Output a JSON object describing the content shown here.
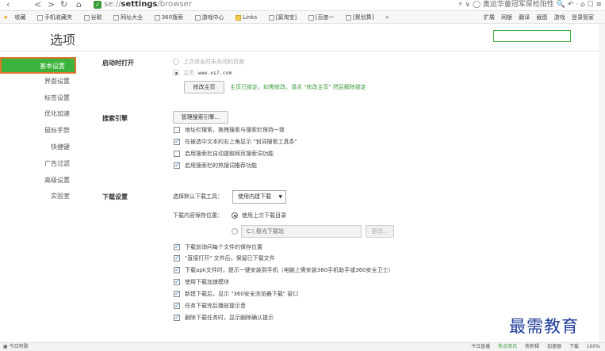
{
  "browser": {
    "url_prefix": "se://",
    "url_path": "settings",
    "url_suffix": "/browser",
    "right_tools": "⚡ ∨ ◯ 奥运华董冠军尿检阳性  🔍  ↶ · ⌂ ☐ ≡",
    "bookmarks": [
      "收藏",
      "手机收藏夹",
      "谷歌",
      "网址大全",
      "360搜索",
      "游戏中心",
      "Links",
      "[窦淘宝]",
      "[百度一",
      "[聚划算]",
      "»"
    ],
    "bookmark_tools": [
      "扩展",
      "网银",
      "翻译",
      "截图",
      "游戏",
      "登录管家"
    ]
  },
  "page": {
    "title": "选项",
    "search_value": ""
  },
  "sidebar": {
    "items": [
      {
        "label": "基本设置",
        "active": true
      },
      {
        "label": "界面设置",
        "active": false
      },
      {
        "label": "标签设置",
        "active": false
      },
      {
        "label": "优化加速",
        "active": false
      },
      {
        "label": "鼠标手势",
        "active": false
      },
      {
        "label": "快捷键",
        "active": false
      },
      {
        "label": "广告过滤",
        "active": false
      },
      {
        "label": "高级设置",
        "active": false
      },
      {
        "label": "实验室",
        "active": false
      }
    ]
  },
  "startup": {
    "title": "启动时打开",
    "option_last": "上次退出时未关闭的页面",
    "option_home_label": "主页",
    "home_url": "www.xs7.com",
    "modify_button": "修改主页",
    "locked_note": "主页已锁定，如需修改，请点 \"修改主页\" 然后解除锁定"
  },
  "search": {
    "title": "搜索引擎",
    "manage_button": "管理搜索引擎...",
    "options": [
      {
        "label": "地址栏搜索，拖拽搜索与搜索栏保持一致",
        "checked": false
      },
      {
        "label": "在被选中文本的右上角显示 \"划词搜索工具条\"",
        "checked": true
      },
      {
        "label": "启用搜索栏自动提取网页搜索词功能",
        "checked": false
      },
      {
        "label": "启用搜索栏的热搜词推荐功能",
        "checked": true
      }
    ]
  },
  "download": {
    "title": "下载设置",
    "tool_label": "选择默认下载工具：",
    "tool_value": "使用内建下载",
    "location_label": "下载内容保存位置：",
    "location_last": "使用上次下载目录",
    "path_value": "C:\\ 极光下载站",
    "change_button": "更改...",
    "options": [
      {
        "label": "下载前询问每个文件的保存位置",
        "checked": true
      },
      {
        "label": "\"直接打开\" 文件后，保留已下载文件",
        "checked": true
      },
      {
        "label": "下载apk文件时，提示一键安装到手机（电脑上需安装360手机助手或360安全卫士）",
        "checked": true
      },
      {
        "label": "使用下载加速模块",
        "checked": true
      },
      {
        "label": "新建下载后，显示 \"360安全浏览器下载\" 窗口",
        "checked": true
      },
      {
        "label": "任务下载完后播放提示音",
        "checked": true
      },
      {
        "label": "删除下载任务时，显示删除确认提示",
        "checked": true
      }
    ]
  },
  "watermark": "最需教育",
  "statusbar": {
    "left": "今日特歌",
    "right": [
      "今日直播",
      "热点资讯",
      "快剪辑",
      "加速器",
      "下载",
      "100%"
    ]
  }
}
